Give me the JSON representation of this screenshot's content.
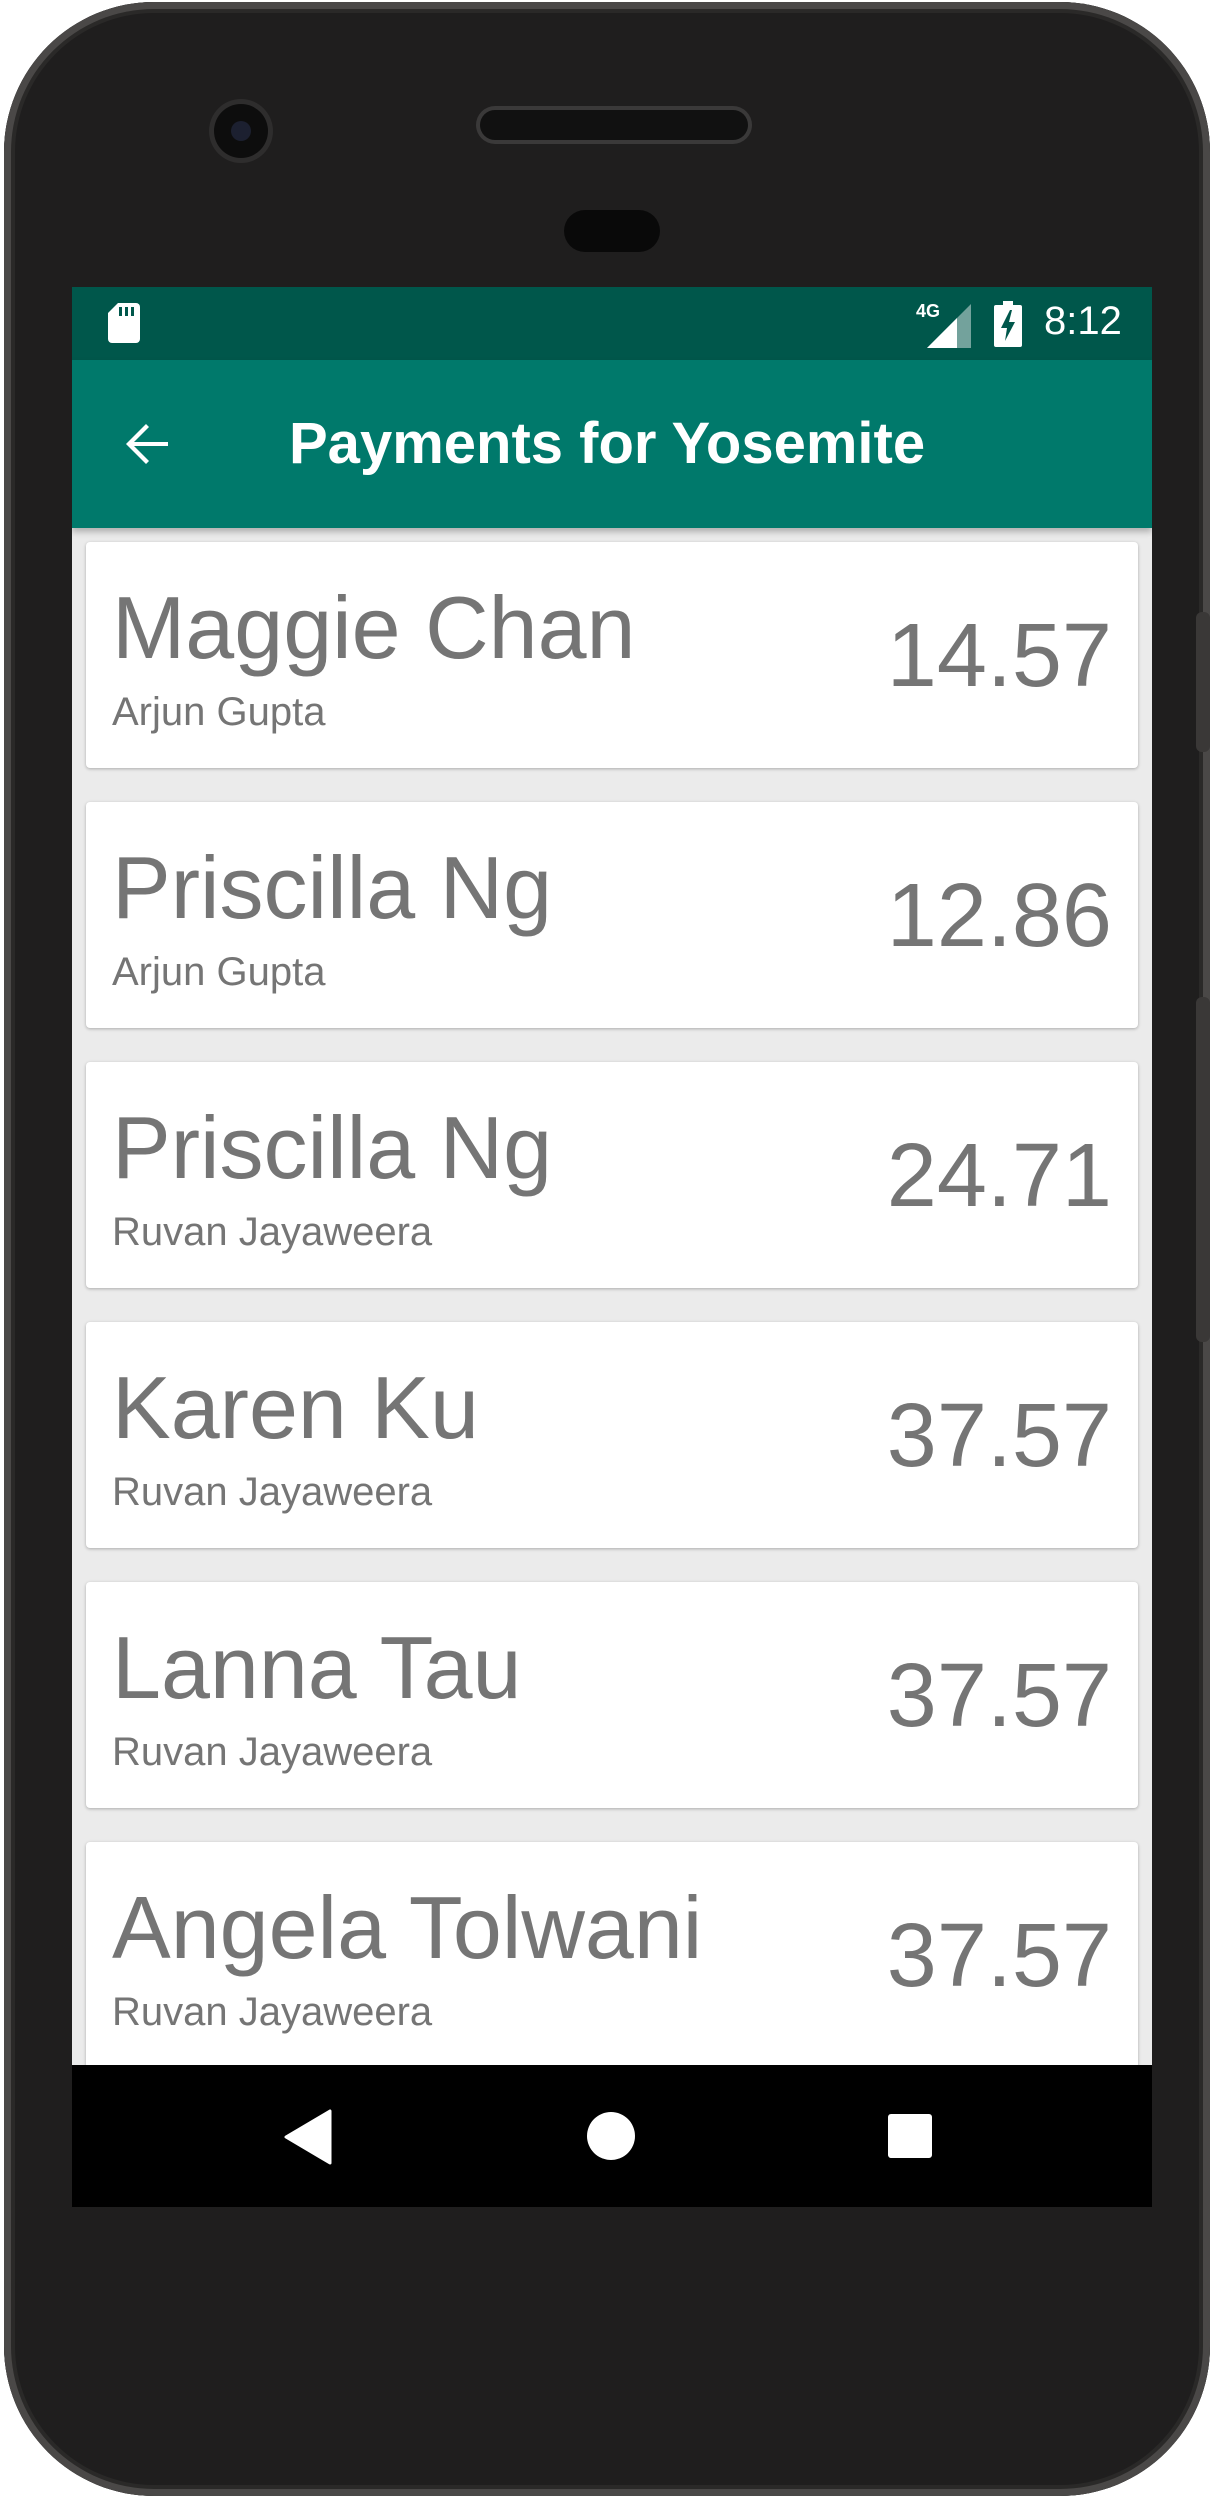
{
  "status_bar": {
    "network_type": "4G",
    "time": "8:12"
  },
  "app_bar": {
    "title": "Payments for Yosemite",
    "back_icon": "arrow-back-icon"
  },
  "payments": [
    {
      "name": "Maggie Chan",
      "payer": "Arjun Gupta",
      "amount": "14.57"
    },
    {
      "name": "Priscilla Ng",
      "payer": "Arjun Gupta",
      "amount": "12.86"
    },
    {
      "name": "Priscilla Ng",
      "payer": "Ruvan Jayaweera",
      "amount": "24.71"
    },
    {
      "name": "Karen Ku",
      "payer": "Ruvan Jayaweera",
      "amount": "37.57"
    },
    {
      "name": "Lanna Tau",
      "payer": "Ruvan Jayaweera",
      "amount": "37.57"
    },
    {
      "name": "Angela Tolwani",
      "payer": "Ruvan Jayaweera",
      "amount": "37.57"
    }
  ],
  "nav_bar": {
    "back_icon": "triangle-back-icon",
    "home_icon": "circle-home-icon",
    "recents_icon": "square-recents-icon"
  },
  "colors": {
    "status_bar": "#00574b",
    "app_bar": "#00796b",
    "card_text": "#757575"
  }
}
